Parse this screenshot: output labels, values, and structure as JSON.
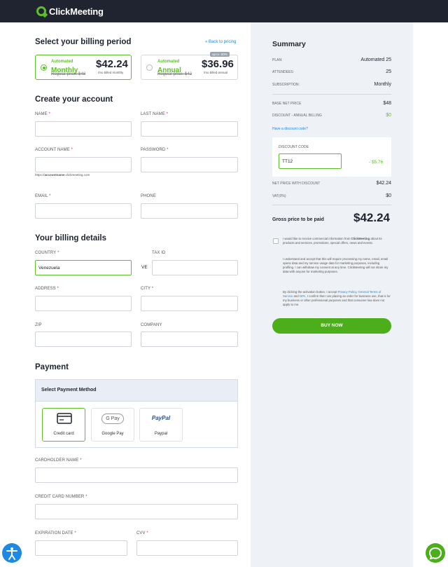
{
  "brand": {
    "name": "ClickMeeting"
  },
  "billing_period": {
    "title": "Select your billing period",
    "back_link": "« Back to pricing",
    "monthly": {
      "plan": "Automated",
      "period": "Monthly",
      "regular": "Regular price: $48",
      "price": "$42.24",
      "note": "/mo billed monthly"
    },
    "annual": {
      "plan": "Automated",
      "period": "Annual",
      "regular": "Regular price: $42",
      "price": "$36.96",
      "note": "/mo billed annual",
      "badge": "up to -20%"
    }
  },
  "account": {
    "title": "Create your account",
    "name_label": "NAME",
    "last_name_label": "LAST NAME",
    "account_name_label": "ACCOUNT NAME",
    "password_label": "PASSWORD",
    "account_hint_prefix": "https://",
    "account_hint_bold": "accountname",
    "account_hint_suffix": ".clickmeeting.com",
    "email_label": "EMAIL",
    "phone_label": "PHONE",
    "required_mark": "*"
  },
  "billing": {
    "title": "Your billing details",
    "country_label": "COUNTRY",
    "country_value": "Venezuela",
    "tax_label": "TAX ID",
    "tax_prefix": "VE",
    "address_label": "ADDRESS",
    "city_label": "CITY",
    "zip_label": "ZIP",
    "company_label": "COMPANY"
  },
  "payment": {
    "title": "Payment",
    "method_heading": "Select Payment Method",
    "methods": [
      {
        "label": "Credit card"
      },
      {
        "label": "Google Pay",
        "logo_text": "G Pay"
      },
      {
        "label": "Paypal",
        "logo_text": "PayPal"
      }
    ],
    "cardholder_label": "CARDHOLDER NAME",
    "card_number_label": "CREDIT CARD NUMBER",
    "expiration_label": "EXPIRATION DATE",
    "cvv_label": "CVV"
  },
  "summary": {
    "title": "Summary",
    "plan_k": "PLAN:",
    "plan_v": "Automated 25",
    "attendees_k": "ATTENDEES:",
    "attendees_v": "25",
    "subscription_k": "SUBSCRIPTION:",
    "subscription_v": "Monthly",
    "base_k": "BASE NET PRICE",
    "base_v": "$48",
    "discount_k": "DISCOUNT - ANNUAL BILLING",
    "discount_v": "$0",
    "discount_link": "Have a discount code?",
    "code_label": "DISCOUNT CODE",
    "code_value": "TT12",
    "code_amount": "- $5.76",
    "net_k": "NET PRICE WITH DISCOUNT",
    "net_v": "$42.24",
    "vat_k": "VAT(0%)",
    "vat_v": "$0",
    "gross_k": "Gross price to be paid",
    "gross_v": "$42.24",
    "consent_1_a": "I would like to receive commercial information from ",
    "consent_1_b": "ClickMeeting",
    "consent_1_c": " about its products and services, promotions, special offers, news and events.",
    "consent_2": "I understand and accept that this will require processing my name, email, email opens data and my service usage data for marketing purposes, including profiling. I can withdraw my consent at any time. ClickMeeting will not share my data with anyone for marketing purposes.",
    "terms_a": "By clicking the activation button, I accept ",
    "terms_pp": "Privacy Policy",
    "terms_sep": ", ",
    "terms_gt": "General Terms of Service",
    "terms_and": " and ",
    "terms_dpa": "DPA",
    "terms_b": ", I confirm that I am placing an order for business use, that is for my business or other professional purposes and that consumer law does not apply to me.",
    "buy_label": "BUY NOW"
  },
  "colors": {
    "accent": "#5cbf2a",
    "button": "#4cae1a",
    "dark": "#1f2430",
    "link": "#1e88e5"
  }
}
